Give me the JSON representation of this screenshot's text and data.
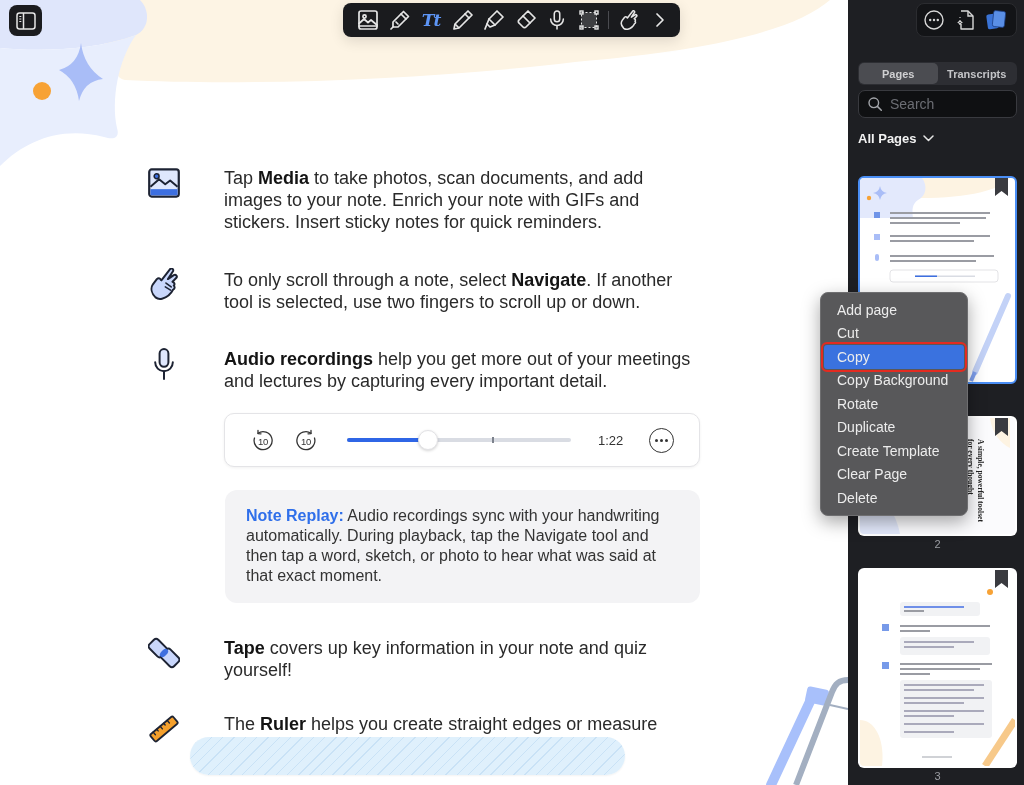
{
  "toolbar": {
    "tools": [
      {
        "kind": "media",
        "selected": false
      },
      {
        "kind": "pen",
        "selected": false
      },
      {
        "kind": "text",
        "label": "Tt",
        "selected": true
      },
      {
        "kind": "pencil",
        "selected": false
      },
      {
        "kind": "highlighter",
        "selected": false
      },
      {
        "kind": "eraser",
        "selected": false
      },
      {
        "kind": "audio",
        "selected": false
      },
      {
        "kind": "select",
        "selected": false
      },
      {
        "kind": "navigate",
        "selected": false
      }
    ]
  },
  "note": {
    "blocks": [
      {
        "kind": "media",
        "text": "Tap **Media** to take photos, scan documents, and add images to your note. Enrich your note with GIFs and stickers. Insert sticky notes for quick reminders."
      },
      {
        "kind": "navigate",
        "text": "To only scroll through a note, select **Navigate**. If another tool is selected, use two fingers to scroll up or down."
      },
      {
        "kind": "audio",
        "text": "**Audio recordings** help you get more out of your meetings and lectures by capturing every important detail."
      },
      {
        "kind": "player",
        "rewind_label": "10",
        "forward_label": "10",
        "level": 0.36,
        "time": "1:22"
      },
      {
        "kind": "tip",
        "label": "Note Replay:",
        "text": "Audio recordings sync with your handwriting automatically. During playback, tap the Navigate tool and then tap a word, sketch, or photo to hear what was said at that exact moment."
      },
      {
        "kind": "tape",
        "text": "**Tape** covers up key information in your note and quiz yourself!"
      },
      {
        "kind": "ruler",
        "text": "The **Ruler** helps you create straight edges or measure"
      }
    ]
  },
  "sidebar": {
    "tabs": [
      {
        "label": "Pages",
        "selected": true
      },
      {
        "label": "Transcripts",
        "selected": false
      }
    ],
    "search": {
      "placeholder": "Search"
    },
    "filter": "All Pages",
    "pages": [
      {
        "kind": "overview",
        "selected": true
      },
      {
        "kind": "cover",
        "title": "A simple, powerful toolset for every thought",
        "label": "2",
        "selected": false
      },
      {
        "kind": "tips",
        "label": "3",
        "selected": false
      }
    ]
  },
  "context_menu": {
    "items": [
      {
        "label": "Add page",
        "selected": false
      },
      {
        "label": "Cut",
        "selected": false
      },
      {
        "label": "Copy",
        "selected": true
      },
      {
        "label": "Copy Background",
        "selected": false
      },
      {
        "label": "Rotate",
        "selected": false
      },
      {
        "label": "Duplicate",
        "selected": false
      },
      {
        "label": "Create Template",
        "selected": false
      },
      {
        "label": "Clear Page",
        "selected": false
      },
      {
        "label": "Delete",
        "selected": false
      }
    ]
  }
}
